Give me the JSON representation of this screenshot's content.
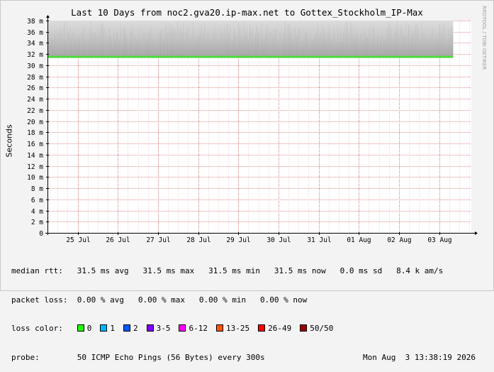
{
  "chart_data": {
    "type": "line",
    "title": "Last 10 Days from noc2.gva20.ip-max.net to Gottex_Stockholm_IP-Max",
    "ylabel": "Seconds",
    "ylim": [
      0,
      38
    ],
    "yticks": [
      {
        "v": 0,
        "label": "0"
      },
      {
        "v": 2,
        "label": "2 m"
      },
      {
        "v": 4,
        "label": "4 m"
      },
      {
        "v": 6,
        "label": "6 m"
      },
      {
        "v": 8,
        "label": "8 m"
      },
      {
        "v": 10,
        "label": "10 m"
      },
      {
        "v": 12,
        "label": "12 m"
      },
      {
        "v": 14,
        "label": "14 m"
      },
      {
        "v": 16,
        "label": "16 m"
      },
      {
        "v": 18,
        "label": "18 m"
      },
      {
        "v": 20,
        "label": "20 m"
      },
      {
        "v": 22,
        "label": "22 m"
      },
      {
        "v": 24,
        "label": "24 m"
      },
      {
        "v": 26,
        "label": "26 m"
      },
      {
        "v": 28,
        "label": "28 m"
      },
      {
        "v": 30,
        "label": "30 m"
      },
      {
        "v": 32,
        "label": "32 m"
      },
      {
        "v": 34,
        "label": "34 m"
      },
      {
        "v": 36,
        "label": "36 m"
      },
      {
        "v": 38,
        "label": "38 m"
      }
    ],
    "xticks": [
      "25 Jul",
      "26 Jul",
      "27 Jul",
      "28 Jul",
      "29 Jul",
      "30 Jul",
      "31 Jul",
      "01 Aug",
      "02 Aug",
      "03 Aug"
    ],
    "xlim_days": [
      0,
      10.55
    ],
    "xtick_days": [
      0.75,
      1.75,
      2.75,
      3.75,
      4.75,
      5.75,
      6.75,
      7.75,
      8.75,
      9.75
    ],
    "series": [
      {
        "name": "median rtt",
        "color": "#4cdc3c",
        "median_ms": 31.5
      }
    ],
    "smoke_range_ms": [
      31.5,
      38
    ],
    "smoke_end_day": 10.1,
    "grid": true,
    "legend": {
      "median_label": "median rtt:",
      "median_values": "31.5 ms avg   31.5 ms max   31.5 ms min   31.5 ms now   0.0 ms sd   8.4 k am/s",
      "loss_label": "packet loss:",
      "loss_values": "0.00 % avg   0.00 % max   0.00 % min   0.00 % now",
      "color_label": "loss color:",
      "colors": [
        {
          "label": "0",
          "color": "#26ff00"
        },
        {
          "label": "1",
          "color": "#00b8ff"
        },
        {
          "label": "2",
          "color": "#0059ff"
        },
        {
          "label": "3-5",
          "color": "#7e00ff"
        },
        {
          "label": "6-12",
          "color": "#ff00ff"
        },
        {
          "label": "13-25",
          "color": "#ff5500"
        },
        {
          "label": "26-49",
          "color": "#ff0000"
        },
        {
          "label": "50/50",
          "color": "#a10000"
        }
      ],
      "probe_label": "probe:",
      "probe_values": "50 ICMP Echo Pings (56 Bytes) every 300s",
      "timestamp": "Mon Aug  3 13:38:19 2026"
    },
    "watermark": "RRDTOOL / TOBI OETIKER"
  }
}
